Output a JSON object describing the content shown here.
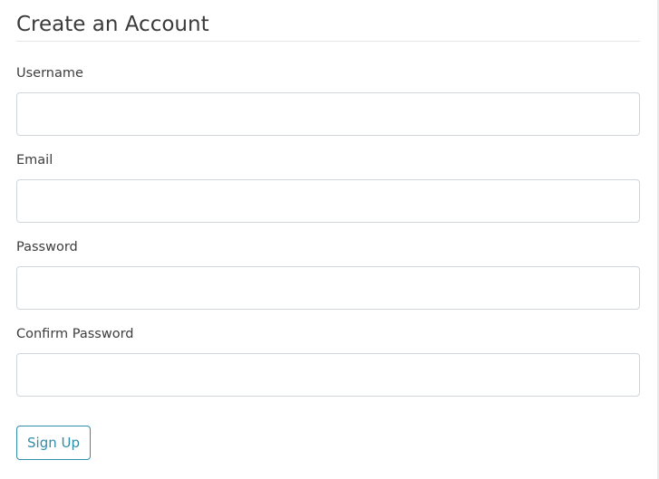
{
  "form": {
    "title": "Create an Account",
    "fields": {
      "username": {
        "label": "Username",
        "value": "",
        "type": "text"
      },
      "email": {
        "label": "Email",
        "value": "",
        "type": "email"
      },
      "password": {
        "label": "Password",
        "value": "",
        "type": "password"
      },
      "confirm_password": {
        "label": "Confirm Password",
        "value": "",
        "type": "password"
      }
    },
    "submit_label": "Sign Up"
  },
  "colors": {
    "accent": "#2f8ea8",
    "input_border": "#cfd5da",
    "text": "#333333",
    "divider": "#e6e6e6"
  }
}
